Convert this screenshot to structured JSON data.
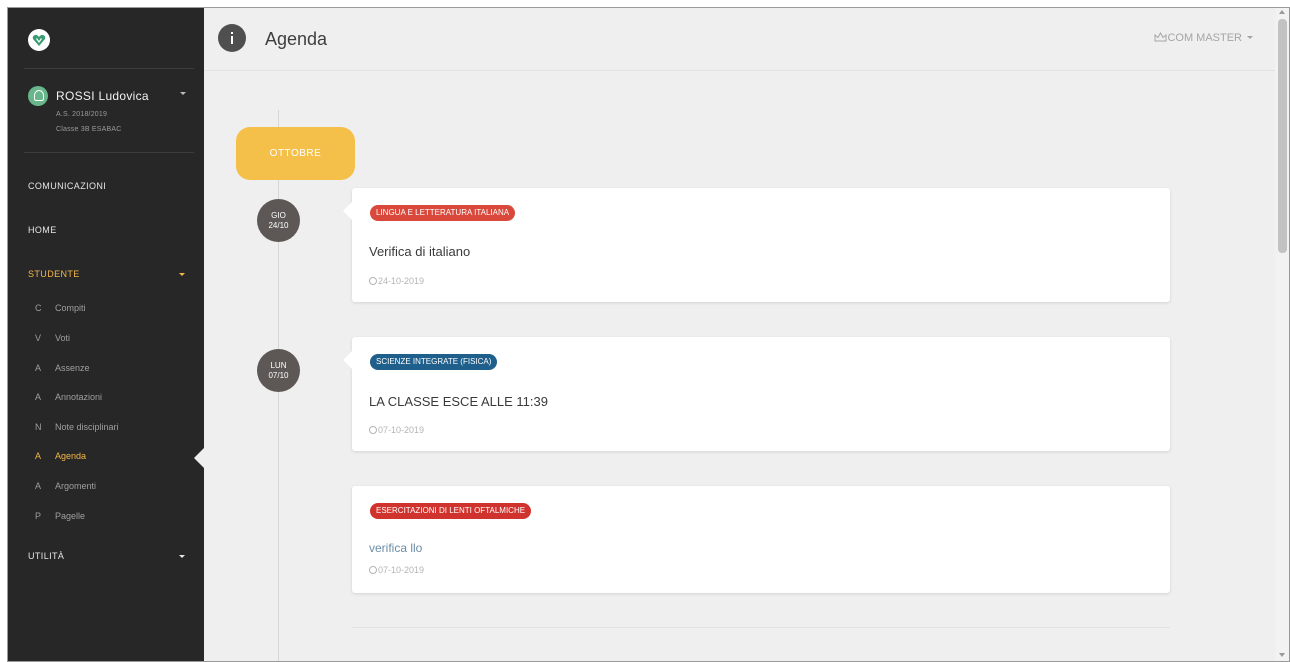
{
  "colors": {
    "accent_yellow": "#f5c04a",
    "sidebar_bg": "#272727",
    "active_text": "#f2b84a"
  },
  "icons": {
    "logo": "heart-shield-logo",
    "user": "user-icon",
    "info": "info-icon",
    "master": "crown-icon",
    "clock": "clock-icon"
  },
  "sidebar": {
    "user": {
      "name": "ROSSI Ludovica",
      "year": "A.S. 2018/2019",
      "class": "Classe 3B ESABAC"
    },
    "top_items": [
      {
        "label": "COMUNICAZIONI"
      },
      {
        "label": "HOME"
      }
    ],
    "studente": {
      "label": "STUDENTE",
      "items": [
        {
          "letter": "C",
          "label": "Compiti"
        },
        {
          "letter": "V",
          "label": "Voti"
        },
        {
          "letter": "A",
          "label": "Assenze"
        },
        {
          "letter": "A",
          "label": "Annotazioni"
        },
        {
          "letter": "N",
          "label": "Note disciplinari"
        },
        {
          "letter": "A",
          "label": "Agenda"
        },
        {
          "letter": "A",
          "label": "Argomenti"
        },
        {
          "letter": "P",
          "label": "Pagelle"
        }
      ]
    },
    "utilita": {
      "label": "UTILITÀ"
    }
  },
  "header": {
    "title": "Agenda",
    "master_label": "COM MASTER"
  },
  "timeline": {
    "month": "OTTOBRE",
    "entries": [
      {
        "day": "GIO",
        "date": "24/10",
        "badge": "LINGUA E LETTERATURA ITALIANA",
        "badge_color": "#d9483b",
        "title": "Verifica di italiano",
        "meta": "24-10-2019"
      },
      {
        "day": "LUN",
        "date": "07/10",
        "badge": "SCIENZE INTEGRATE (FISICA)",
        "badge_color": "#1f5f8b",
        "title": "LA CLASSE ESCE ALLE 11:39",
        "meta": "07-10-2019"
      },
      {
        "badge": "ESERCITAZIONI DI LENTI OFTALMICHE",
        "badge_color": "#d0332e",
        "title": "verifica llo",
        "meta": "07-10-2019"
      }
    ]
  }
}
